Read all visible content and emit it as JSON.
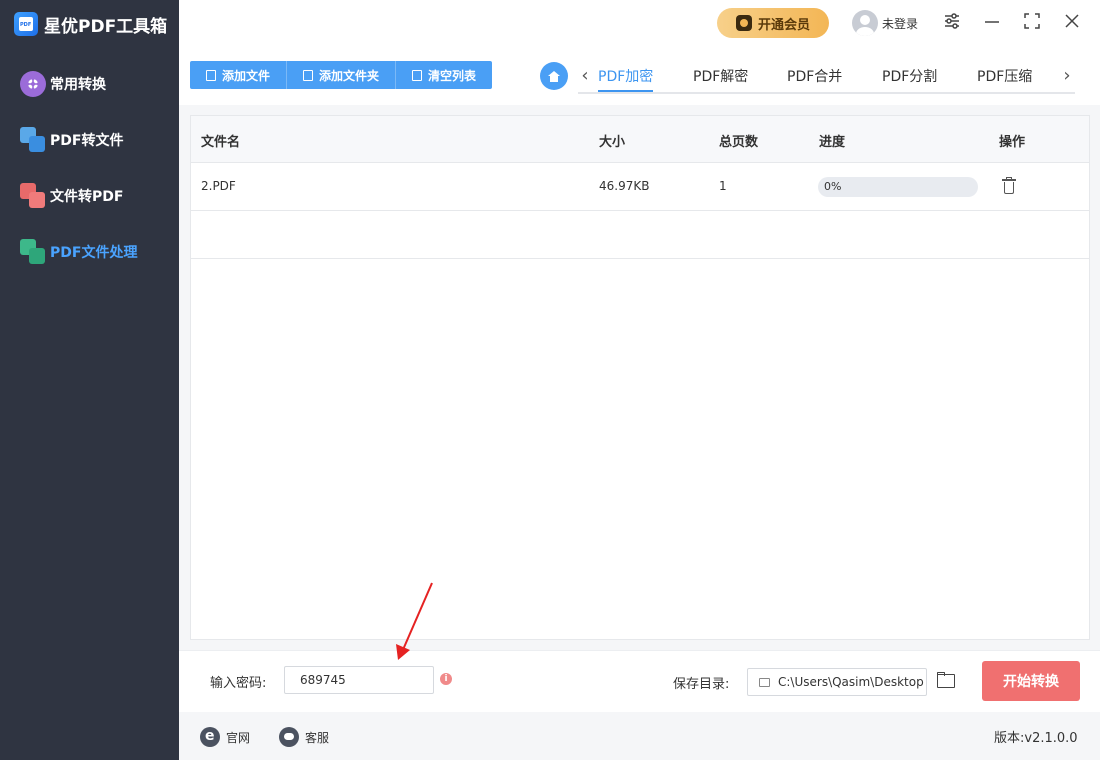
{
  "app": {
    "name": "星优PDF工具箱"
  },
  "sidebar": {
    "items": [
      {
        "label": "常用转换"
      },
      {
        "label": "PDF转文件"
      },
      {
        "label": "文件转PDF"
      },
      {
        "label": "PDF文件处理"
      }
    ]
  },
  "header": {
    "vip_label": "开通会员",
    "user_label": "未登录"
  },
  "toolbar": {
    "add_file": "添加文件",
    "add_folder": "添加文件夹",
    "clear_list": "清空列表"
  },
  "tabs": [
    "PDF加密",
    "PDF解密",
    "PDF合并",
    "PDF分割",
    "PDF压缩"
  ],
  "table": {
    "headers": [
      "文件名",
      "大小",
      "总页数",
      "进度",
      "操作"
    ],
    "rows": [
      {
        "name": "2.PDF",
        "size": "46.97KB",
        "pages": "1",
        "progress_text": "0%",
        "progress": 0
      }
    ]
  },
  "bottom": {
    "password_label": "输入密码:",
    "password_value": "689745",
    "save_dir_label": "保存目录:",
    "save_dir_value": "C:\\Users\\Qasim\\Desktop",
    "start_button": "开始转换"
  },
  "footer": {
    "website": "官网",
    "support": "客服",
    "version": "版本:v2.1.0.0"
  },
  "colors": {
    "accent": "#4a9ff5",
    "sidebar_bg": "#2f3441",
    "start_button": "#f07070",
    "vip": "#f3b655"
  }
}
